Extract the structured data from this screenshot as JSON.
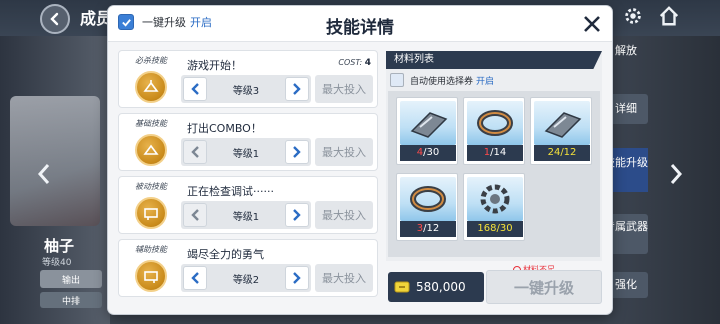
{
  "topbar": {
    "title": "成员"
  },
  "header": {
    "auto_toggle_label": "一键升级",
    "auto_toggle_state": "开启",
    "title": "技能详情"
  },
  "skills": [
    {
      "type": "必杀技能",
      "name": "游戏开始！",
      "cost_label": "COST:",
      "cost": "4",
      "level": "等级3",
      "max_label": "最大投入"
    },
    {
      "type": "基础技能",
      "name": "打出COMBO！",
      "level": "等级1",
      "max_label": "最大投入"
    },
    {
      "type": "被动技能",
      "name": "正在检查调试······",
      "level": "等级1",
      "max_label": "最大投入"
    },
    {
      "type": "辅助技能",
      "name": "竭尽全力的勇气",
      "level": "等级2",
      "max_label": "最大投入"
    }
  ],
  "materials": {
    "header": "材料列表",
    "auto_use_label": "自动使用选择券",
    "auto_use_state": "开启",
    "items": [
      {
        "icon": "chip-plate-icon",
        "have": "4",
        "need": "/30",
        "sufficient": false
      },
      {
        "icon": "ring-part-icon",
        "have": "1",
        "need": "/14",
        "sufficient": false
      },
      {
        "icon": "chip-plate-icon",
        "have": "24",
        "need": "/12",
        "sufficient": true
      },
      {
        "icon": "ring-part-icon",
        "have": "3",
        "need": "/12",
        "sufficient": false
      },
      {
        "icon": "gear-part-icon",
        "have": "168",
        "need": "/30",
        "sufficient": true
      }
    ],
    "insufficient_text": "材料不足。"
  },
  "footer": {
    "gold_amount": "580,000",
    "upgrade_label": "一键升级"
  },
  "character": {
    "name": "柚子",
    "rank": "等级40",
    "role": "输出",
    "position": "中排"
  },
  "side_menu": {
    "release": "解放",
    "detail": "详细",
    "skill_upgrade": "技能升级",
    "exclusive_weapon": "专属武器",
    "enhance": "强化"
  },
  "colors": {
    "accent_blue": "#2b6cc4",
    "panel_dark": "#2c3a4f",
    "skill_gold": "#c98a1a",
    "warn_red": "#e8303a",
    "ok_yellow": "#f5e23a"
  }
}
